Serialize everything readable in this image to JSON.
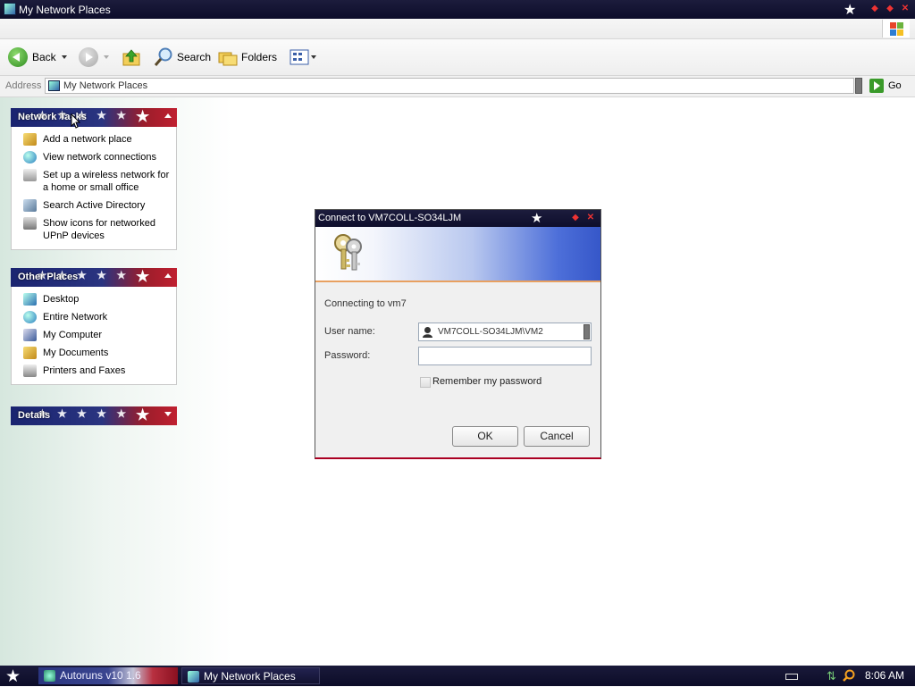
{
  "window": {
    "title": "My Network Places"
  },
  "toolbar": {
    "back_label": "Back",
    "search_label": "Search",
    "folders_label": "Folders"
  },
  "address": {
    "label": "Address",
    "value": "My Network Places",
    "go_label": "Go"
  },
  "panels": {
    "network_tasks": {
      "title": "Network Tasks",
      "items": [
        {
          "label": "Add a network place"
        },
        {
          "label": "View network connections"
        },
        {
          "label": "Set up a wireless network for a home or small office"
        },
        {
          "label": "Search Active Directory"
        },
        {
          "label": "Show icons for networked UPnP devices"
        }
      ]
    },
    "other_places": {
      "title": "Other Places",
      "items": [
        {
          "label": "Desktop"
        },
        {
          "label": "Entire Network"
        },
        {
          "label": "My Computer"
        },
        {
          "label": "My Documents"
        },
        {
          "label": "Printers and Faxes"
        }
      ]
    },
    "details": {
      "title": "Details"
    }
  },
  "dialog": {
    "title": "Connect to VM7COLL-SO34LJM",
    "connecting_text": "Connecting to vm7",
    "username_label": "User name:",
    "username_value": "VM7COLL-SO34LJM\\VM2",
    "password_label": "Password:",
    "password_value": "",
    "remember_label": "Remember my password",
    "remember_checked": false,
    "ok_label": "OK",
    "cancel_label": "Cancel"
  },
  "taskbar": {
    "tasks": [
      {
        "label": "Autoruns v10 1.6"
      },
      {
        "label": "My Network Places"
      }
    ],
    "clock": "8:06 AM"
  },
  "colors": {
    "title_bar": "#0d0d2a",
    "panel_blue": "#1a2470",
    "panel_red": "#c02030",
    "banner_blue": "#3657c9"
  }
}
